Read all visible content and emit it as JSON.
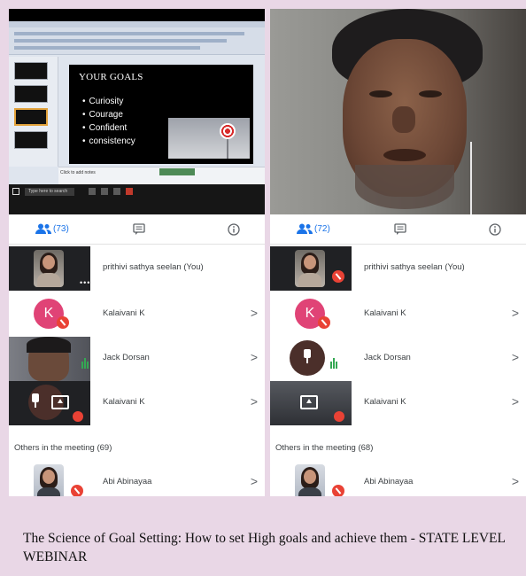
{
  "left": {
    "screen_share": {
      "slide_title": "YOUR GOALS",
      "bullets": [
        "Curiosity",
        "Courage",
        "Confident",
        "consistency"
      ],
      "notes_hint": "Click to add notes",
      "taskbar_search": "Type here to search"
    },
    "tabs": {
      "people_count": "(73)"
    },
    "participants": [
      {
        "name": "prithivi sathya seelan (You)"
      },
      {
        "name": "Kalaivani K",
        "initial": "K"
      },
      {
        "name": "Jack Dorsan"
      },
      {
        "name": "Kalaivani K"
      }
    ],
    "others_label": "Others in the meeting (69)",
    "others": [
      {
        "name": "Abi Abinayaa"
      }
    ]
  },
  "right": {
    "tabs": {
      "people_count": "(72)"
    },
    "participants": [
      {
        "name": "prithivi sathya seelan (You)"
      },
      {
        "name": "Kalaivani K",
        "initial": "K"
      },
      {
        "name": "Jack Dorsan"
      },
      {
        "name": "Kalaivani K"
      }
    ],
    "others_label": "Others in the meeting (68)",
    "others": [
      {
        "name": "Abi Abinayaa"
      }
    ]
  },
  "chevron": ">",
  "caption": "The Science of Goal Setting: How to set High goals and achieve them - STATE LEVEL WEBINAR",
  "colors": {
    "accent": "#1a73e8",
    "avatar_k": "#e04376",
    "mic_off": "#e94235",
    "speaking": "#34a853"
  },
  "icons": [
    "people-icon",
    "chat-icon",
    "info-icon",
    "mic-off-icon",
    "pin-icon",
    "present-icon",
    "chevron-right-icon"
  ]
}
